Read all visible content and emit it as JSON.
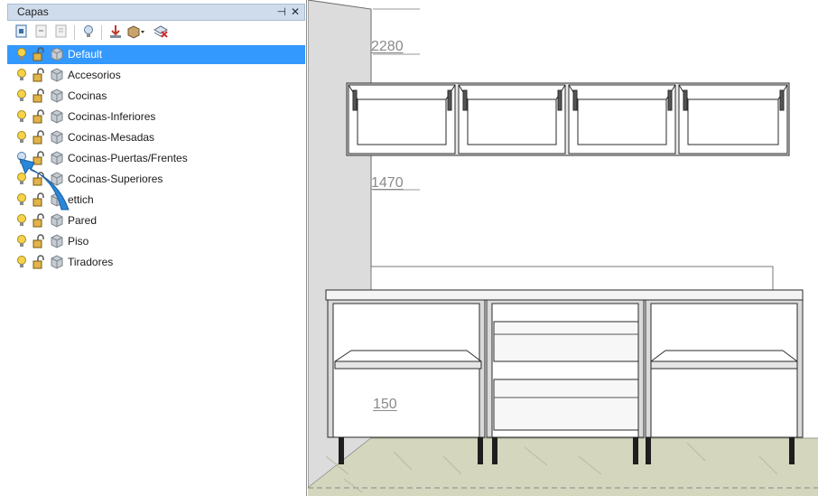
{
  "panel": {
    "title": "Capas",
    "pin_glyph": "⊣",
    "close_glyph": "✕",
    "toolbar": [
      {
        "name": "new-layer-icon"
      },
      {
        "name": "delete-layer-icon"
      },
      {
        "name": "layer-properties-icon"
      },
      {
        "name": "bulb-toggle-icon"
      },
      {
        "name": "move-down-icon"
      },
      {
        "name": "box-dropdown-icon"
      },
      {
        "name": "layer-manager-icon"
      }
    ],
    "layers": [
      {
        "label": "Default",
        "selected": true,
        "bulb": "on"
      },
      {
        "label": "Accesorios",
        "selected": false,
        "bulb": "on"
      },
      {
        "label": "Cocinas",
        "selected": false,
        "bulb": "on"
      },
      {
        "label": "Cocinas-Inferiores",
        "selected": false,
        "bulb": "on"
      },
      {
        "label": "Cocinas-Mesadas",
        "selected": false,
        "bulb": "on"
      },
      {
        "label": "Cocinas-Puertas/Frentes",
        "selected": false,
        "bulb": "off"
      },
      {
        "label": "Cocinas-Superiores",
        "selected": false,
        "bulb": "on"
      },
      {
        "label": "ettich",
        "selected": false,
        "bulb": "on"
      },
      {
        "label": "Pared",
        "selected": false,
        "bulb": "on"
      },
      {
        "label": "Piso",
        "selected": false,
        "bulb": "on"
      },
      {
        "label": "Tiradores",
        "selected": false,
        "bulb": "on"
      }
    ]
  },
  "viewport": {
    "dimensions": [
      "2280",
      "1470",
      "150"
    ]
  },
  "colors": {
    "selection": "#3399ff",
    "wall": "#dcdcdc",
    "floor": "#d4d6be",
    "bulb_on": "#f5d34a",
    "arrow": "#2a86d8"
  }
}
